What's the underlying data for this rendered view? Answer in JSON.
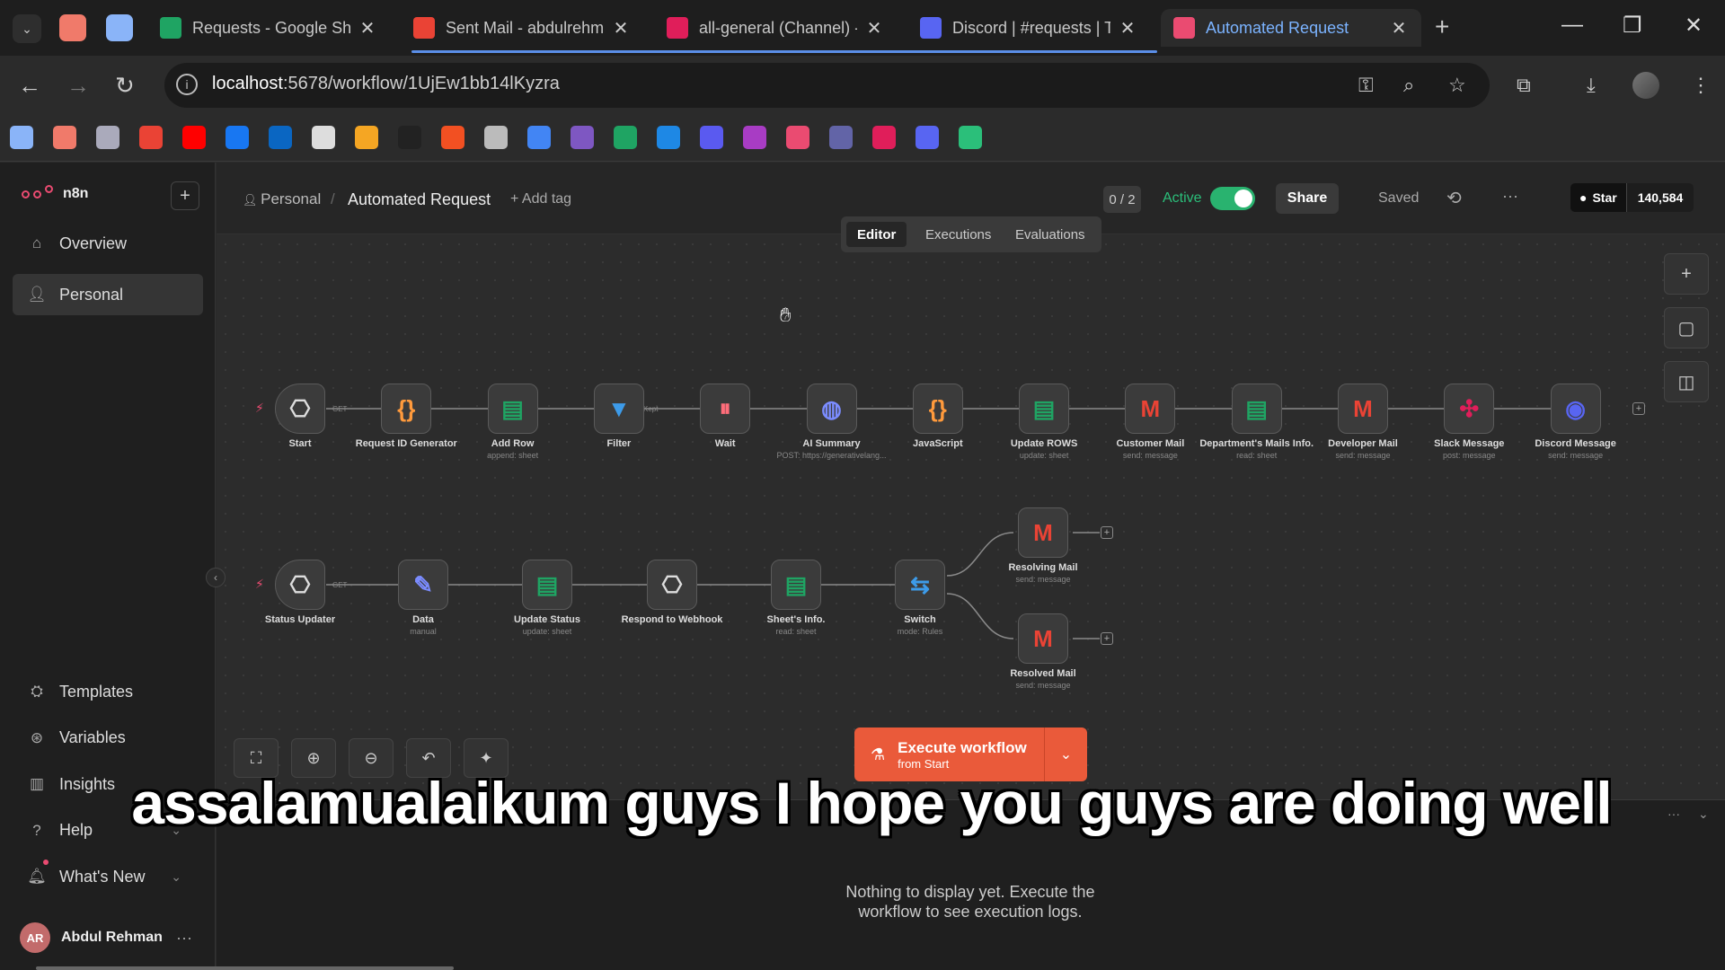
{
  "browser": {
    "tabs": [
      {
        "label": "Requests - Google She",
        "icon": "google-sheets-icon",
        "color": "#1fa463"
      },
      {
        "label": "Sent Mail - abdulrehm",
        "icon": "gmail-icon",
        "color": "#ea4335"
      },
      {
        "label": "all-general (Channel) -",
        "icon": "slack-icon",
        "color": "#e01e5a"
      },
      {
        "label": "Discord | #requests | T",
        "icon": "discord-icon",
        "color": "#5865f2"
      },
      {
        "label": "Automated Request",
        "icon": "n8n-icon",
        "color": "#ea4b71",
        "active": true
      }
    ],
    "url_host": "localhost",
    "url_path": ":5678/workflow/1UjEw1bb14lKyzra"
  },
  "sidebar": {
    "brand": "n8n",
    "items_top": [
      {
        "label": "Overview",
        "icon": "home-icon"
      },
      {
        "label": "Personal",
        "icon": "user-icon",
        "selected": true
      }
    ],
    "items_bottom": [
      {
        "label": "Templates",
        "icon": "templates-icon"
      },
      {
        "label": "Variables",
        "icon": "variables-icon"
      },
      {
        "label": "Insights",
        "icon": "insights-icon"
      },
      {
        "label": "Help",
        "icon": "help-icon"
      },
      {
        "label": "What's New",
        "icon": "bell-icon"
      }
    ],
    "user": {
      "initials": "AR",
      "name": "Abdul Rehman"
    }
  },
  "header": {
    "breadcrumb_project": "Personal",
    "separator": "/",
    "workflow_name": "Automated Request",
    "add_tag": "+ Add tag",
    "counter": "0 / 2",
    "active_label": "Active",
    "share": "Share",
    "saved": "Saved",
    "github_star": "Star",
    "github_count": "140,584",
    "tabs": [
      "Editor",
      "Executions",
      "Evaluations"
    ]
  },
  "workflow": {
    "row1": [
      {
        "label": "Start",
        "sub": "",
        "icon": "webhook-icon",
        "glyph": "⎔",
        "color": "#dddddd",
        "trigger": true
      },
      {
        "label": "Request ID Generator",
        "sub": "",
        "icon": "code-icon",
        "glyph": "{}",
        "color": "#ff9a3c"
      },
      {
        "label": "Add Row",
        "sub": "append: sheet",
        "icon": "google-sheets-icon",
        "glyph": "▤",
        "color": "#1fa463"
      },
      {
        "label": "Filter",
        "sub": "",
        "icon": "filter-icon",
        "glyph": "▼",
        "color": "#3d9be9"
      },
      {
        "label": "Wait",
        "sub": "",
        "icon": "pause-icon",
        "glyph": "⏸",
        "color": "#ff6d7a"
      },
      {
        "label": "AI Summary",
        "sub": "POST: https://generativelang...",
        "icon": "globe-icon",
        "glyph": "◍",
        "color": "#7b8cff"
      },
      {
        "label": "JavaScript",
        "sub": "",
        "icon": "code-icon",
        "glyph": "{}",
        "color": "#ff9a3c"
      },
      {
        "label": "Update ROWS",
        "sub": "update: sheet",
        "icon": "google-sheets-icon",
        "glyph": "▤",
        "color": "#1fa463"
      },
      {
        "label": "Customer Mail",
        "sub": "send: message",
        "icon": "gmail-icon",
        "glyph": "M",
        "color": "#ea4335"
      },
      {
        "label": "Department's Mails Info.",
        "sub": "read: sheet",
        "icon": "google-sheets-icon",
        "glyph": "▤",
        "color": "#1fa463"
      },
      {
        "label": "Developer Mail",
        "sub": "send: message",
        "icon": "gmail-icon",
        "glyph": "M",
        "color": "#ea4335"
      },
      {
        "label": "Slack Message",
        "sub": "post: message",
        "icon": "slack-icon",
        "glyph": "✣",
        "color": "#e01e5a"
      },
      {
        "label": "Discord Message",
        "sub": "send: message",
        "icon": "discord-icon",
        "glyph": "◉",
        "color": "#5865f2"
      }
    ],
    "row2": [
      {
        "label": "Status Updater",
        "sub": "",
        "icon": "webhook-icon",
        "glyph": "⎔",
        "color": "#dddddd",
        "trigger": true
      },
      {
        "label": "Data",
        "sub": "manual",
        "icon": "pencil-icon",
        "glyph": "✎",
        "color": "#7b8cff"
      },
      {
        "label": "Update Status",
        "sub": "update: sheet",
        "icon": "google-sheets-icon",
        "glyph": "▤",
        "color": "#1fa463"
      },
      {
        "label": "Respond to Webhook",
        "sub": "",
        "icon": "webhook-icon",
        "glyph": "⎔",
        "color": "#dddddd"
      },
      {
        "label": "Sheet's Info.",
        "sub": "read: sheet",
        "icon": "google-sheets-icon",
        "glyph": "▤",
        "color": "#1fa463"
      },
      {
        "label": "Switch",
        "sub": "mode: Rules",
        "icon": "switch-icon",
        "glyph": "⇆",
        "color": "#3d9be9"
      }
    ],
    "branches": [
      {
        "label": "Resolving Mail",
        "sub": "send: message",
        "icon": "gmail-icon",
        "glyph": "M",
        "color": "#ea4335"
      },
      {
        "label": "Resolved Mail",
        "sub": "send: message",
        "icon": "gmail-icon",
        "glyph": "M",
        "color": "#ea4335"
      }
    ],
    "edge_labels": [
      "GET",
      "Kept"
    ]
  },
  "execute": {
    "label": "Execute workflow",
    "sub": "from Start"
  },
  "logs": {
    "message": "Nothing to display yet. Execute the workflow to see execution logs."
  },
  "subtitle": "assalamualaikum guys I hope you guys are doing well",
  "colors": {
    "accent": "#ea4b71",
    "execute": "#ea5a3a",
    "active": "#29b36f"
  }
}
